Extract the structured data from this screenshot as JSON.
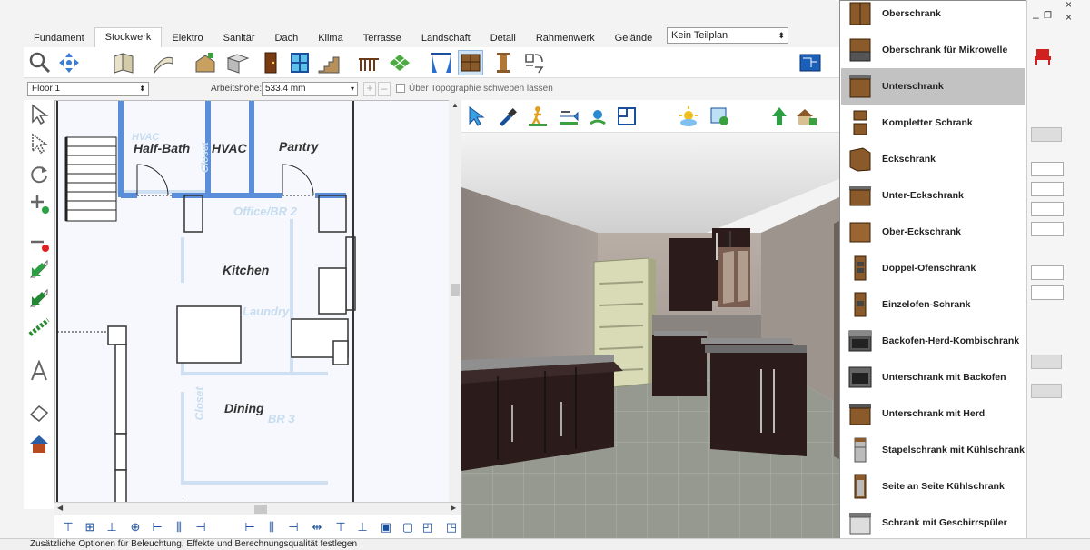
{
  "tabs": [
    "Fundament",
    "Stockwerk",
    "Elektro",
    "Sanitär",
    "Dach",
    "Klima",
    "Terrasse",
    "Landschaft",
    "Detail",
    "Rahmenwerk",
    "Gelände"
  ],
  "active_tab": "Stockwerk",
  "subplan_select": "Kein Teilplan",
  "floor_select": "Floor 1",
  "working_height_label": "Arbeitshöhe:",
  "working_height_value": "533.4 mm",
  "topography_label": "Über Topographie schweben lassen",
  "plan": {
    "rooms": [
      "Half-Bath",
      "HVAC",
      "Pantry",
      "Kitchen",
      "Dining"
    ],
    "ghost_labels": [
      "HVAC",
      "Closet",
      "Office/BR 2",
      "Laundry",
      "Closet",
      "BR 3"
    ]
  },
  "statusbar_text": "Zusätzliche Optionen für Beleuchtung, Effekte und Berechnungsqualität festlegen",
  "catalog": {
    "items": [
      "Oberschrank",
      "Oberschrank für Mikrowelle",
      "Unterschrank",
      "Kompletter Schrank",
      "Eckschrank",
      "Unter-Eckschrank",
      "Ober-Eckschrank",
      "Doppel-Ofenschrank",
      "Einzelofen-Schrank",
      "Backofen-Herd-Kombischrank",
      "Unterschrank mit Backofen",
      "Unterschrank mit Herd",
      "Stapelschrank mit Kühlschrank",
      "Seite an Seite Kühlschrank",
      "Schrank mit Geschirrspüler"
    ],
    "selected": "Unterschrank"
  },
  "window_controls": {
    "close": "×",
    "minimize": "–",
    "restore": "❐"
  },
  "colors": {
    "wall_blue": "#5b8ed8",
    "cabinet_wood": "#8a5a2b",
    "selection_gray": "#c2c2c2"
  }
}
